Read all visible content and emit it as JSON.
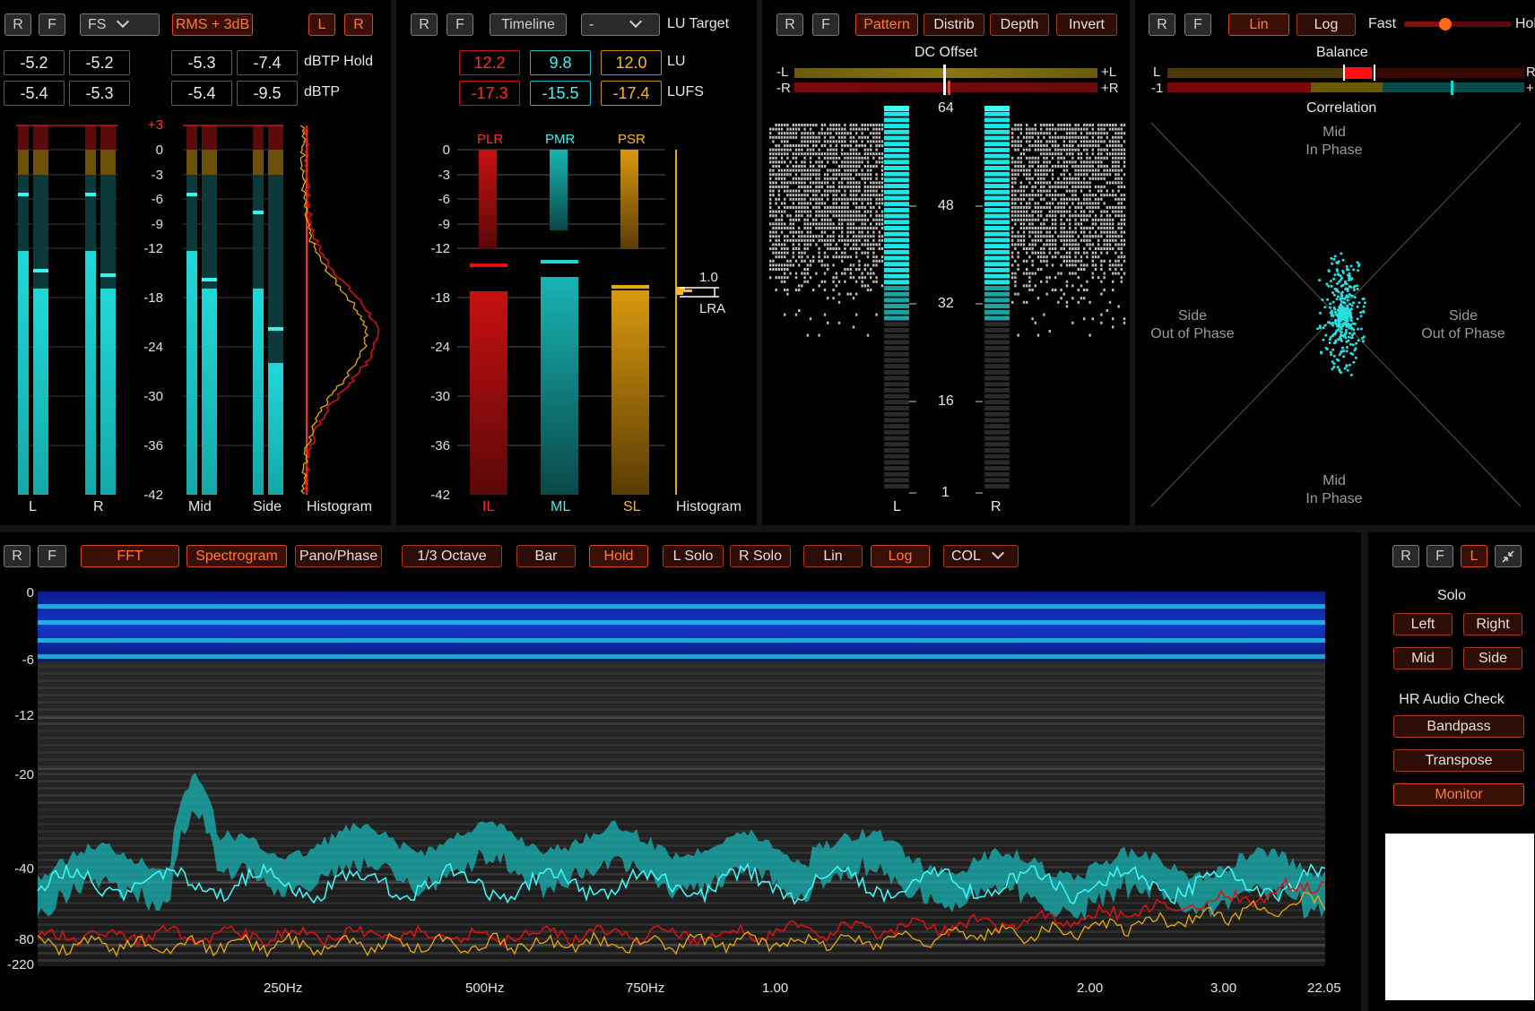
{
  "colors": {
    "cyan": "#1fd6d6",
    "red": "#e01010",
    "orange": "#e8a810",
    "accent": "#ff6a2a"
  },
  "levels": {
    "buttons": {
      "r": "R",
      "f": "F",
      "scale": "FS",
      "rms": "RMS + 3dB",
      "l": "L",
      "rr": "R"
    },
    "hold_values": [
      "-5.2",
      "-5.2",
      "-5.3",
      "-7.4"
    ],
    "tp_values": [
      "-5.4",
      "-5.3",
      "-5.4",
      "-9.5"
    ],
    "hold_label": "dBTP Hold",
    "tp_label": "dBTP",
    "scale_top": "+3",
    "scale": [
      "0",
      "-3",
      "-6",
      "-9",
      "-12",
      "-18",
      "-24",
      "-30",
      "-36",
      "-42"
    ],
    "labels": {
      "l": "L",
      "r": "R",
      "mid": "Mid",
      "side": "Side",
      "histogram": "Histogram"
    }
  },
  "loudness": {
    "buttons": {
      "r": "R",
      "f": "F",
      "timeline": "Timeline",
      "target_select": "-",
      "target_label": "LU Target"
    },
    "lu_values": [
      "12.2",
      "9.8",
      "12.0"
    ],
    "lufs_values": [
      "-17.3",
      "-15.5",
      "-17.4"
    ],
    "lu_label": "LU",
    "lufs_label": "LUFS",
    "col_top": [
      "PLR",
      "PMR",
      "PSR"
    ],
    "col_bottom": [
      "IL",
      "ML",
      "SL"
    ],
    "scale": [
      "0",
      "-3",
      "-6",
      "-9",
      "-12",
      "-18",
      "-24",
      "-30",
      "-36",
      "-42"
    ],
    "lra_value": "1.0",
    "lra_label": "LRA",
    "histogram": "Histogram"
  },
  "bits": {
    "buttons": {
      "r": "R",
      "f": "F",
      "pattern": "Pattern",
      "distrib": "Distrib",
      "depth": "Depth",
      "invert": "Invert"
    },
    "dc_label": "DC Offset",
    "neg_l": "-L",
    "pos_l": "+L",
    "neg_r": "-R",
    "pos_r": "+R",
    "scale": [
      "64",
      "48",
      "32",
      "16",
      "1"
    ],
    "l": "L",
    "r": "R"
  },
  "vector": {
    "buttons": {
      "r": "R",
      "f": "F",
      "lin": "Lin",
      "log": "Log"
    },
    "fast": "Fast",
    "hold": "Hol",
    "balance": "Balance",
    "bal_l": "L",
    "bal_r": "R",
    "corr_neg": "-1",
    "corr_pos": "+",
    "correlation": "Correlation",
    "mid_top": "Mid\nIn Phase",
    "mid_bottom": "Mid\nIn Phase",
    "side_left": "Side\nOut of Phase",
    "side_right": "Side\nOut of Phase"
  },
  "spectrum": {
    "buttons": [
      "R",
      "F",
      "FFT",
      "Spectrogram",
      "Pano/Phase",
      "1/3 Octave",
      "Bar",
      "Hold",
      "L Solo",
      "R Solo",
      "Lin",
      "Log",
      "COL"
    ],
    "y_labels": [
      "0",
      "-6",
      "-12",
      "-20",
      "-40",
      "-80",
      "-220"
    ],
    "x_labels": [
      "250Hz",
      "500Hz",
      "750Hz",
      "1.00",
      "2.00",
      "3.00",
      "22.05"
    ]
  },
  "side": {
    "buttons": {
      "r": "R",
      "f": "F",
      "l": "L"
    },
    "solo": "Solo",
    "solo_buttons": [
      "Left",
      "Right",
      "Mid",
      "Side"
    ],
    "hr_label": "HR Audio Check",
    "hr_buttons": [
      "Bandpass",
      "Transpose",
      "Monitor"
    ]
  }
}
